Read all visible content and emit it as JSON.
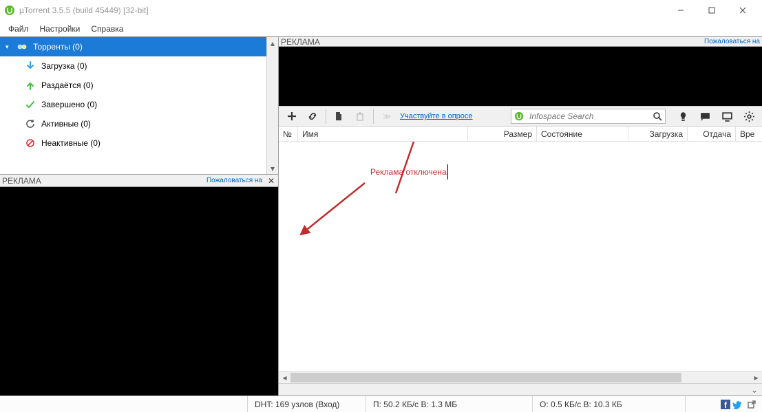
{
  "window": {
    "title": "µTorrent 3.5.5  (build 45449) [32-bit]"
  },
  "menu": {
    "file": "Файл",
    "settings": "Настройки",
    "help": "Справка"
  },
  "sidebar": {
    "items": [
      {
        "label": "Торренты (0)"
      },
      {
        "label": "Загрузка (0)"
      },
      {
        "label": "Раздаётся (0)"
      },
      {
        "label": "Завершено (0)"
      },
      {
        "label": "Активные (0)"
      },
      {
        "label": "Неактивные (0)"
      }
    ]
  },
  "ads": {
    "label": "РЕКЛАМА",
    "complain": "Пожаловаться на"
  },
  "toolbar": {
    "survey_link": "Участвуйте в опросе",
    "search_placeholder": "Infospace Search"
  },
  "columns": {
    "num": "№",
    "name": "Имя",
    "size": "Размер",
    "state": "Состояние",
    "download": "Загрузка",
    "upload": "Отдача",
    "time": "Вре"
  },
  "annotation": {
    "text": "Реклама отключена"
  },
  "status": {
    "dht": "DHT: 169 узлов  (Вход)",
    "download": "П: 50.2 КБ/с В: 1.3 МБ",
    "upload": "О: 0.5 КБ/с В: 10.3 КБ"
  }
}
